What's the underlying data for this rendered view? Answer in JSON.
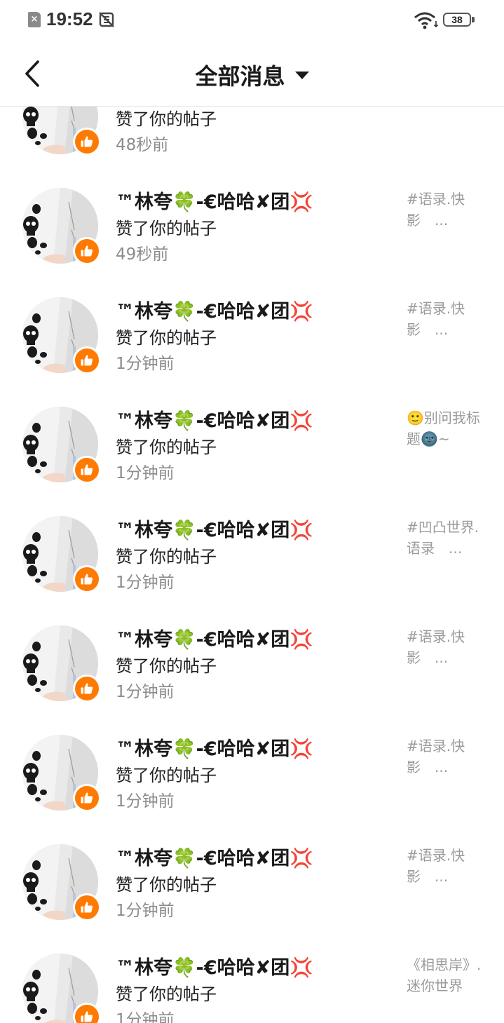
{
  "status_bar": {
    "time": "19:52",
    "battery": "38",
    "sim_icon": "sim-off-icon",
    "alarm_icon": "alarm-off-icon",
    "wifi_icon": "wifi-icon"
  },
  "header": {
    "title": "全部消息",
    "back_icon": "chevron-left-icon",
    "dropdown_icon": "caret-down-icon"
  },
  "colors": {
    "accent": "#ff7a00",
    "text_primary": "#1a1a1a",
    "text_secondary": "#8c8c8c",
    "text_tertiary": "#9a9a9a"
  },
  "messages": [
    {
      "name": "",
      "action": "赞了你的帖子",
      "time": "48秒前",
      "preview": ""
    },
    {
      "name": "™林夸🍀-€哈哈✘团💢",
      "action": "赞了你的帖子",
      "time": "49秒前",
      "preview": "#语录.快影　..."
    },
    {
      "name": "™林夸🍀-€哈哈✘团💢",
      "action": "赞了你的帖子",
      "time": "1分钟前",
      "preview": "#语录.快影　..."
    },
    {
      "name": "™林夸🍀-€哈哈✘团💢",
      "action": "赞了你的帖子",
      "time": "1分钟前",
      "preview": "🙂别问我标题🌚~"
    },
    {
      "name": "™林夸🍀-€哈哈✘团💢",
      "action": "赞了你的帖子",
      "time": "1分钟前",
      "preview": "#凹凸世界.语录　..."
    },
    {
      "name": "™林夸🍀-€哈哈✘团💢",
      "action": "赞了你的帖子",
      "time": "1分钟前",
      "preview": "#语录.快影　..."
    },
    {
      "name": "™林夸🍀-€哈哈✘团💢",
      "action": "赞了你的帖子",
      "time": "1分钟前",
      "preview": "#语录.快影　..."
    },
    {
      "name": "™林夸🍀-€哈哈✘团💢",
      "action": "赞了你的帖子",
      "time": "1分钟前",
      "preview": "#语录.快影　..."
    },
    {
      "name": "™林夸🍀-€哈哈✘团💢",
      "action": "赞了你的帖子",
      "time": "1分钟前",
      "preview": "《相思岸》.迷你世界"
    }
  ]
}
